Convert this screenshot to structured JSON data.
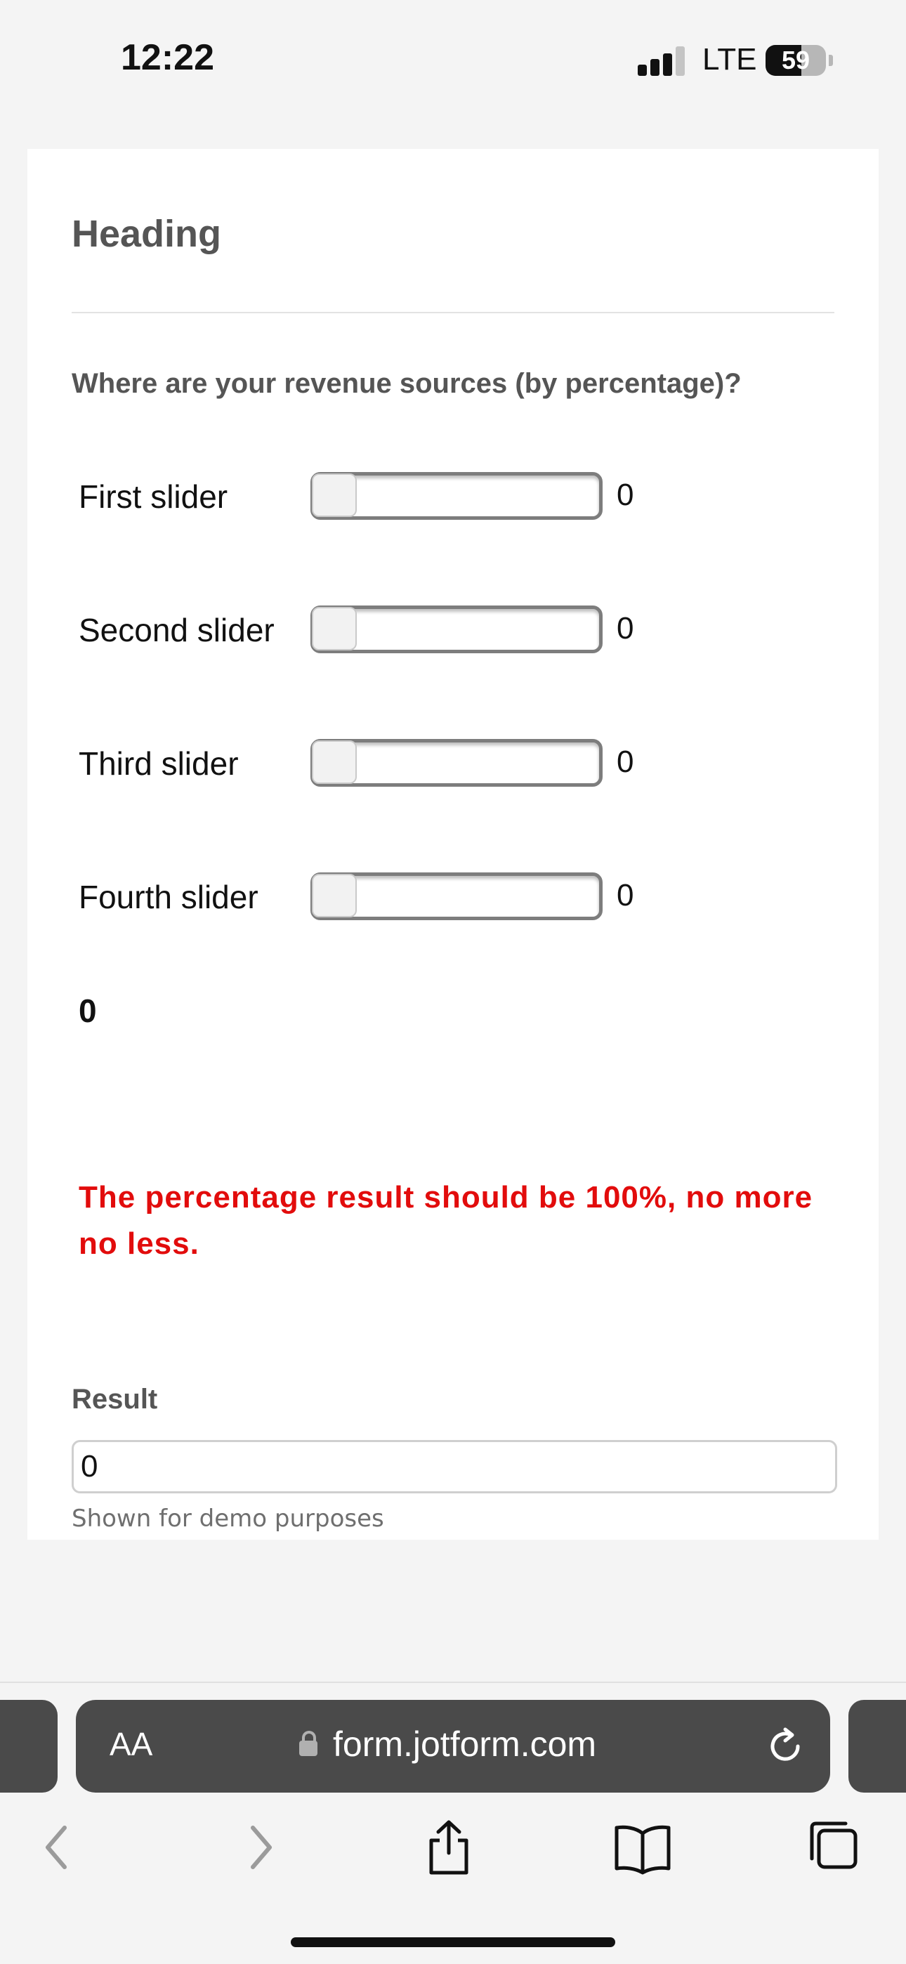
{
  "status_bar": {
    "time": "12:22",
    "network": "LTE",
    "battery_level": "59",
    "battery_fraction": 0.59
  },
  "form": {
    "heading": "Heading",
    "question": "Where are your revenue sources (by percentage)?",
    "sliders": [
      {
        "label": "First slider",
        "value": "0"
      },
      {
        "label": "Second slider",
        "value": "0"
      },
      {
        "label": "Third slider",
        "value": "0"
      },
      {
        "label": "Fourth slider",
        "value": "0"
      }
    ],
    "total": "0",
    "warning": "The percentage result should be 100%, no more no less.",
    "result": {
      "label": "Result",
      "value": "0",
      "helper": "Shown for demo purposes"
    }
  },
  "browser": {
    "text_size_button": "AA",
    "url": "form.jotform.com",
    "icons": [
      "lock-icon",
      "reload-icon",
      "back-icon",
      "forward-icon",
      "share-icon",
      "bookmarks-icon",
      "tabs-icon"
    ]
  },
  "colors": {
    "warning": "#e20c0c",
    "address_bar": "#4a4a4a",
    "label_gray": "#555555"
  }
}
